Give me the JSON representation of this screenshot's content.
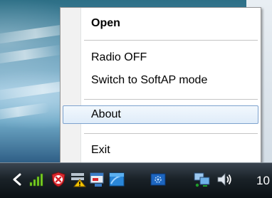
{
  "menu": {
    "items": {
      "open": "Open",
      "radio_off": "Radio OFF",
      "softap": "Switch to SoftAP mode",
      "about": "About",
      "exit": "Exit"
    },
    "highlighted": "About"
  },
  "taskbar": {
    "clock_partial": "10",
    "tray_icons": [
      "chevron-left-icon",
      "signal-strength-icon",
      "security-alert-icon",
      "network-warning-icon",
      "media-icon",
      "settings-icon",
      "network-icon",
      "volume-icon"
    ]
  },
  "colors": {
    "menu_highlight_border": "#7da2ce",
    "menu_highlight_fill": "#dfecf9",
    "taskbar": "#1a2228"
  }
}
